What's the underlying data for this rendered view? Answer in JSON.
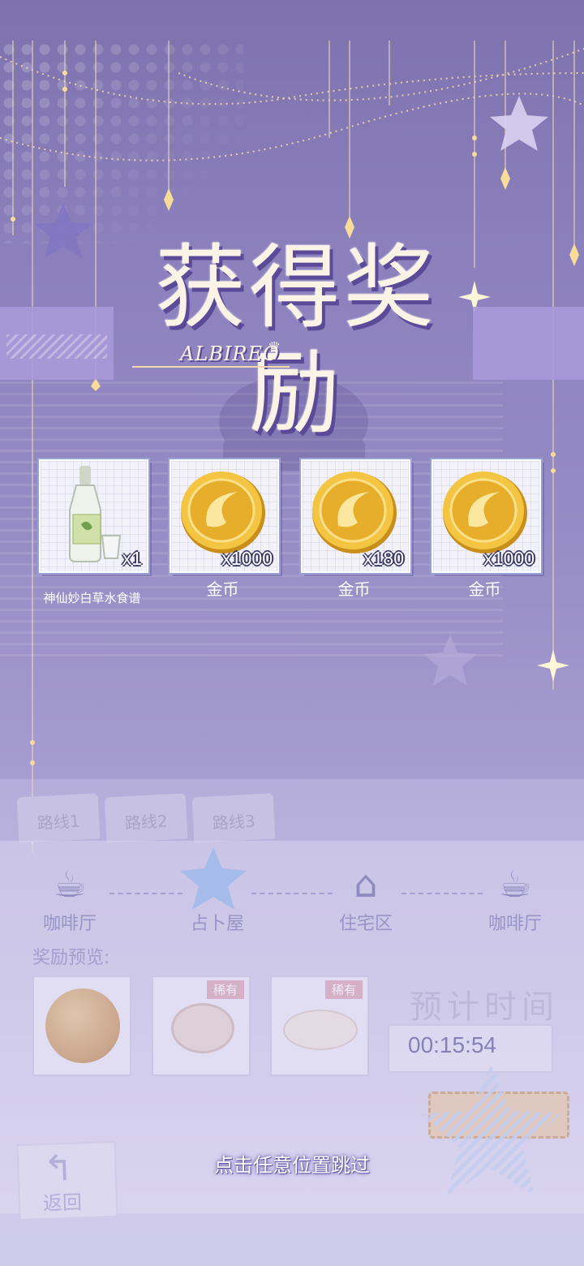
{
  "title": {
    "main": "获得奖励",
    "subtitle": "ALBIREO"
  },
  "rewards": [
    {
      "name": "神仙妙白草水食谱",
      "quantity": "x1",
      "icon": "bottle-icon"
    },
    {
      "name": "金币",
      "quantity": "x1000",
      "icon": "gold-coin-icon"
    },
    {
      "name": "金币",
      "quantity": "x180",
      "icon": "gold-coin-icon"
    },
    {
      "name": "金币",
      "quantity": "x1000",
      "icon": "gold-coin-icon"
    }
  ],
  "background_ui": {
    "routes": [
      "路线1",
      "路线2",
      "路线3"
    ],
    "stations": [
      {
        "label": "咖啡厅",
        "icon": "coffee-cup-icon"
      },
      {
        "label": "占卜屋",
        "icon": "star-icon"
      },
      {
        "label": "住宅区",
        "icon": "house-icon"
      },
      {
        "label": "咖啡厅",
        "icon": "coffee-cup-icon"
      }
    ],
    "preview_label": "奖励预览:",
    "preview_tags": [
      "稀有",
      "稀有"
    ],
    "eta_label": "预计时间",
    "eta_time": "00:15:54",
    "back_label": "返回"
  },
  "hint": "点击任意位置跳过",
  "colors": {
    "background_top": "#7d72ad",
    "background_bottom": "#e4e0f3",
    "title_text": "#fbf3e6",
    "title_shadow": "#5b4a98",
    "card_border": "#9ca0d8"
  }
}
